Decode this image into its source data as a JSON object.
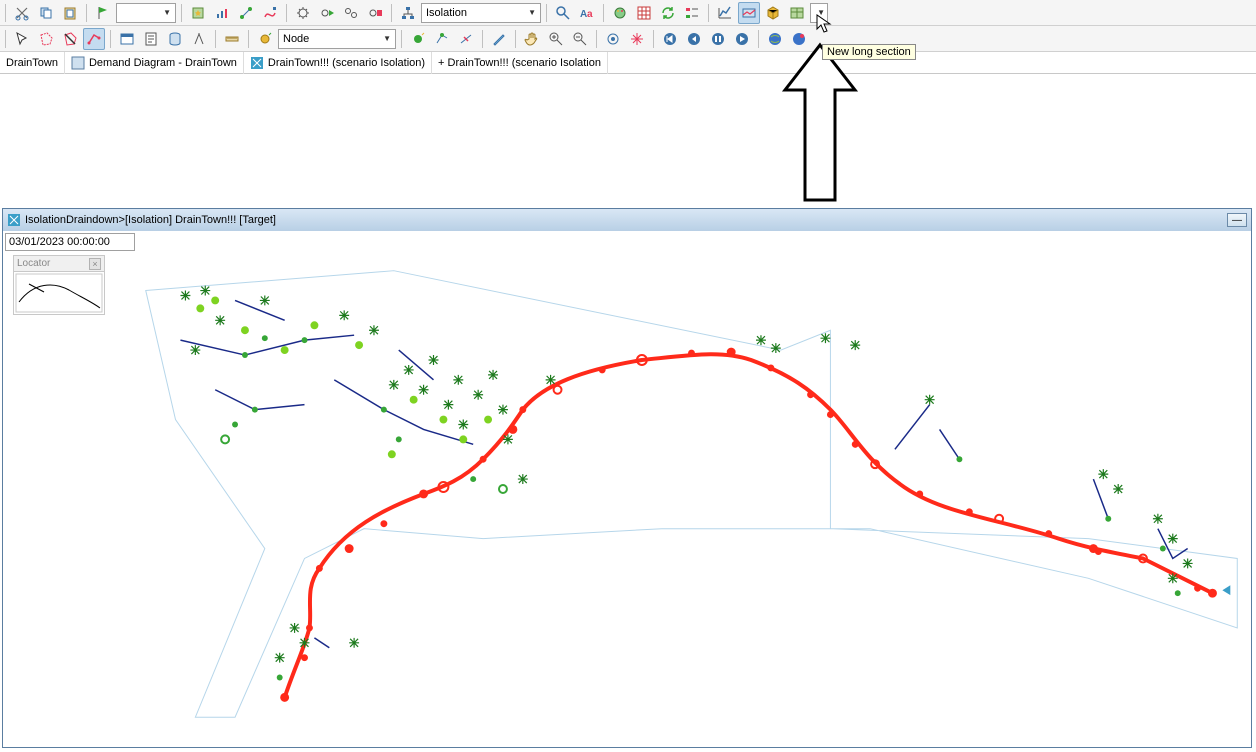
{
  "toolbar1": {
    "combo1_value": "",
    "scenario_combo": "Isolation"
  },
  "toolbar2": {
    "object_type_combo": "Node"
  },
  "tooltip_text": "New long section",
  "tabs": [
    {
      "label": "DrainTown",
      "icon": "doc"
    },
    {
      "label": "Demand Diagram - DrainTown",
      "icon": "diagram"
    },
    {
      "label": "DrainTown!!! (scenario Isolation)",
      "icon": "geo"
    },
    {
      "label": "+ DrainTown!!! (scenario Isolation",
      "icon": "none"
    }
  ],
  "window": {
    "title": "IsolationDraindown>[Isolation] DrainTown!!!  [Target]",
    "datetime": "03/01/2023 00:00:00",
    "locator_label": "Locator"
  },
  "icons": {
    "cut": "cut-icon",
    "copy": "copy-icon",
    "paste": "paste-icon",
    "flag": "flag-icon"
  }
}
